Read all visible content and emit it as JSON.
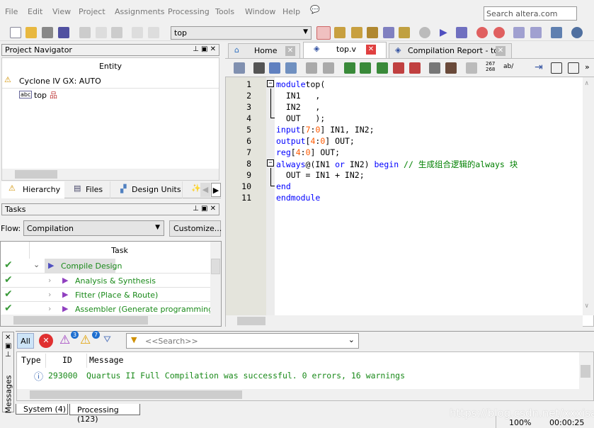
{
  "menu": [
    "File",
    "Edit",
    "View",
    "Project",
    "Assignments",
    "Processing",
    "Tools",
    "Window",
    "Help"
  ],
  "search_placeholder": "Search altera.com",
  "toolbar": {
    "entity_combo": "top"
  },
  "project_navigator": {
    "title": "Project Navigator",
    "column": "Entity",
    "device": "Cyclone IV GX: AUTO",
    "top_entity": "top",
    "tabs": [
      "Hierarchy",
      "Files",
      "Design Units"
    ]
  },
  "tasks": {
    "title": "Tasks",
    "flow_label": "Flow:",
    "flow_value": "Compilation",
    "customize": "Customize...",
    "column": "Task",
    "items": [
      {
        "label": "Compile Design",
        "status": "done"
      },
      {
        "label": "Analysis & Synthesis",
        "status": "done"
      },
      {
        "label": "Fitter (Place & Route)",
        "status": "done"
      },
      {
        "label": "Assembler (Generate programming files)",
        "status": "done"
      }
    ]
  },
  "editor": {
    "tabs": [
      "Home",
      "top.v",
      "Compilation Report - top"
    ],
    "toolbar_text": [
      "267\n268",
      "ab/"
    ],
    "lines": [
      [
        [
          "kw",
          "module"
        ],
        [
          "",
          "top("
        ]
      ],
      [
        [
          "",
          "  IN1   ,"
        ]
      ],
      [
        [
          "",
          "  IN2   ,"
        ]
      ],
      [
        [
          "",
          "  OUT   );"
        ]
      ],
      [
        [
          "kw",
          "input"
        ],
        [
          "",
          "["
        ],
        [
          "num",
          "7"
        ],
        [
          "",
          ":"
        ],
        [
          "num",
          "0"
        ],
        [
          "",
          "] IN1, IN2;"
        ]
      ],
      [
        [
          "kw",
          "output"
        ],
        [
          "",
          "["
        ],
        [
          "num",
          "4"
        ],
        [
          "",
          ":"
        ],
        [
          "num",
          "0"
        ],
        [
          "",
          "] OUT;"
        ]
      ],
      [
        [
          "kw",
          "reg"
        ],
        [
          "",
          "["
        ],
        [
          "num",
          "4"
        ],
        [
          "",
          ":"
        ],
        [
          "num",
          "0"
        ],
        [
          "",
          "] OUT;"
        ]
      ],
      [
        [
          "kw",
          "always"
        ],
        [
          "",
          "@(IN1 "
        ],
        [
          "kw",
          "or"
        ],
        [
          "",
          " IN2) "
        ],
        [
          "kw",
          "begin"
        ],
        [
          "cm",
          " // 生成组合逻辑的always 块"
        ]
      ],
      [
        [
          "",
          "  OUT = IN1 + IN2;"
        ]
      ],
      [
        [
          "kw",
          "end"
        ]
      ],
      [
        [
          "kw",
          "endmodule"
        ]
      ]
    ]
  },
  "messages": {
    "panel_label": "Messages",
    "filter_all": "All",
    "badge_critical": "3",
    "badge_warning": "7",
    "search_placeholder": "<<Search>>",
    "columns": [
      "Type",
      "ID",
      "Message"
    ],
    "rows": [
      {
        "type": "info",
        "id": "293000",
        "message": "Quartus II Full Compilation was successful. 0 errors, 16 warnings"
      }
    ],
    "tabs": [
      "System (4)",
      "Processing (123)"
    ]
  },
  "watermark": "https://blog.csdn.net/xxxisail",
  "status": {
    "zoom": "100%",
    "elapsed": "00:00:25"
  },
  "colors": {
    "keyword": "#0000ff",
    "number": "#ff5a00",
    "comment": "#008000",
    "success": "#1a8a1a"
  }
}
